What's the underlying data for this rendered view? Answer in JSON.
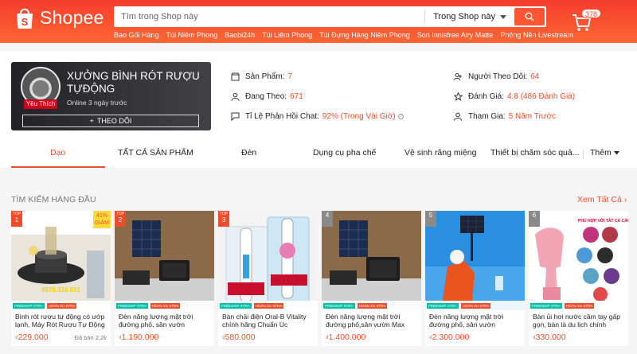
{
  "header": {
    "logo_text": "Shopee",
    "search_placeholder": "Tìm trong Shop này",
    "search_scope": "Trong Shop này",
    "keywords": [
      "Bao Gối Hàng",
      "Túi Niêm Phong",
      "Baobi24h",
      "Túi Liêm Phong",
      "Túi Đựng Hàng Niêm Phong",
      "Son Innisfree Airy Matte",
      "Phông Nền Livestream"
    ],
    "cart_count": "378"
  },
  "shop": {
    "name": "XƯỞNG BÌNH RÓT RƯỢU TỰĐỘNG",
    "online": "Online 3 ngày trước",
    "badge": "Yêu Thích",
    "follow_label": "THEO DÕI",
    "stats": {
      "products_label": "Sản Phẩm:",
      "products_value": "7",
      "following_label": "Đang Theo:",
      "following_value": "671",
      "response_label": "Tỉ Lệ Phản Hồi Chat:",
      "response_value": "92% (Trong Vài Giờ)",
      "followers_label": "Người Theo Dõi:",
      "followers_value": "64",
      "rating_label": "Đánh Giá:",
      "rating_value": "4.8 (486 Đánh Giá)",
      "joined_label": "Tham Gia:",
      "joined_value": "5 Năm Trước"
    }
  },
  "tabs": [
    "Dạo",
    "TẤT CẢ SẢN PHẨM",
    "Đèn",
    "Dụng cụ pha chế",
    "Vệ sinh răng miệng",
    "Thiết bị chăm sóc quả...",
    "Thêm"
  ],
  "top_search": {
    "title": "TÌM KIẾM HÀNG ĐẦU",
    "see_all": "Xem Tất Cả",
    "products": [
      {
        "rank": "1",
        "name": "Bình rót rượu tự động có ướp lạnh, Máy Rót Rượu Tự Động",
        "price": "229.000",
        "sold": "Đã bán 2,2k",
        "sale": "41%",
        "sale_label": "GIẢM",
        "phone": "0978.316.891"
      },
      {
        "rank": "2",
        "name": "Đèn năng lượng mặt trời đường phố, sân vườn Maxsolar công...",
        "price": "1.190.000",
        "sold": ""
      },
      {
        "rank": "3",
        "name": "Bàn chải điện Oral-B Vitality chính hãng Chuẩn Úc",
        "price": "580.000",
        "sold": ""
      },
      {
        "rank": "4",
        "name": "Đèn năng lượng mặt trời đường phố,sân vườn Max Solar cộng...",
        "price": "1.400.000",
        "sold": ""
      },
      {
        "rank": "5",
        "name": "Đèn năng lượng mặt trời đường phố, sân vườn Maxsolar cộng...",
        "price": "2.300.000",
        "sold": ""
      },
      {
        "rank": "6",
        "name": "Bàn ủi hơi nước cầm tay gấp gọn, bàn là du lịch chính hãng...",
        "price": "330.000",
        "sold": "",
        "overlay": "PHÙ HỢP VỚI TẤT CẢ CÁC LOẠI VẢI"
      }
    ],
    "top_label": "TOP",
    "freeship": "FREESHIP XTRA",
    "hoantien": "HOÀN XU XTRA",
    "currency": "₫"
  }
}
